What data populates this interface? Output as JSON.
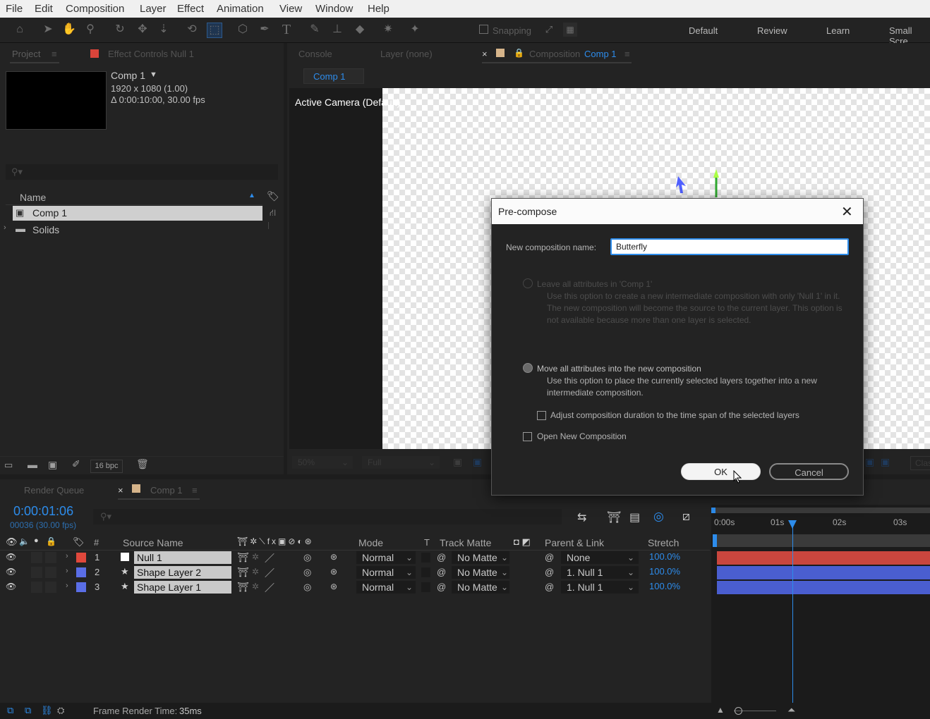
{
  "menu": [
    "File",
    "Edit",
    "Composition",
    "Layer",
    "Effect",
    "Animation",
    "View",
    "Window",
    "Help"
  ],
  "toolbar": {
    "snapping_label": "Snapping",
    "workspaces": [
      "Default",
      "Review",
      "Learn",
      "Small Scre"
    ]
  },
  "project_panel": {
    "tab_label": "Project",
    "effect_controls_label": "Effect Controls Null 1",
    "comp_name": "Comp 1",
    "comp_size": "1920 x 1080 (1.00)",
    "comp_duration": "Δ 0:00:10:00, 30.00 fps",
    "search_placeholder": "",
    "name_header": "Name",
    "items": [
      "Comp 1",
      "Solids"
    ],
    "bpc_label": "16 bpc"
  },
  "viewer": {
    "console_tab": "Console",
    "layer_tab": "Layer (none)",
    "composition_tab_prefix": "Composition",
    "composition_tab_name": "Comp 1",
    "breadcrumb": "Comp 1",
    "camera_label": "Active Camera (Default)",
    "zoom": "50%",
    "resolution": "Full"
  },
  "dialog": {
    "title": "Pre-compose",
    "name_label": "New composition name:",
    "name_value": "Butterfly",
    "option1_label": "Leave all attributes in 'Comp 1'",
    "option1_desc": "Use this option to create a new intermediate composition with only 'Null 1' in it. The new composition will become the source to the current layer. This option is not available because more than one layer is selected.",
    "option2_label": "Move all attributes into the new composition",
    "option2_desc": "Use this option to place the currently selected layers together into a new intermediate composition.",
    "adjust_label": "Adjust composition duration to the time span of the selected layers",
    "open_label": "Open New Composition",
    "ok_label": "OK",
    "cancel_label": "Cancel"
  },
  "timeline": {
    "render_queue_tab": "Render Queue",
    "comp_tab": "Comp 1",
    "timecode": "0:00:01:06",
    "frames": "00036 (30.00 fps)",
    "headers": {
      "num": "#",
      "source": "Source Name",
      "mode": "Mode",
      "t": "T",
      "track_matte": "Track Matte",
      "parent": "Parent & Link",
      "stretch": "Stretch"
    },
    "ruler": [
      "0:00s",
      "01s",
      "02s",
      "03s"
    ],
    "layers": [
      {
        "num": "1",
        "name": "Null 1",
        "mode": "Normal",
        "matte": "No Matte",
        "parent": "None",
        "stretch": "100.0%",
        "color": "#e0483c",
        "bar": "#c9463e"
      },
      {
        "num": "2",
        "name": "Shape Layer 2",
        "mode": "Normal",
        "matte": "No Matte",
        "parent": "1. Null 1",
        "stretch": "100.0%",
        "color": "#5a6ee6",
        "bar": "#4a5ed0"
      },
      {
        "num": "3",
        "name": "Shape Layer 1",
        "mode": "Normal",
        "matte": "No Matte",
        "parent": "1. Null 1",
        "stretch": "100.0%",
        "color": "#5a6ee6",
        "bar": "#4a5ed0"
      }
    ],
    "playhead_fraction": 0.41
  },
  "status": {
    "frame_render_label": "Frame Render Time:",
    "frame_render_value": "35ms"
  }
}
